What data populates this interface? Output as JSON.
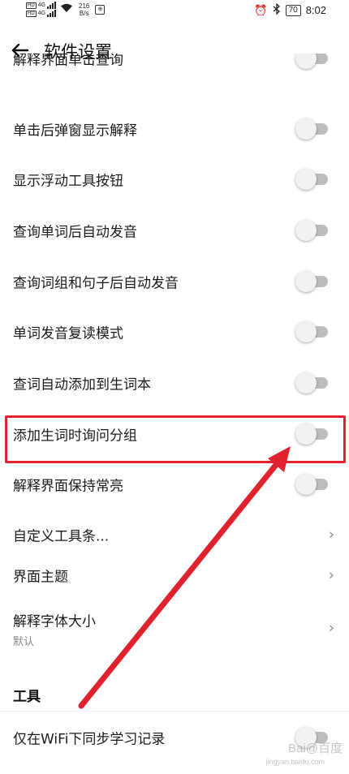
{
  "status_bar": {
    "sim1_label": "HD",
    "sim1_net": "4G",
    "sim2_label": "HD",
    "sim2_net": "4G",
    "net_speed_value": "216",
    "net_speed_unit": "B/s",
    "battery": "70",
    "time": "8:02"
  },
  "header": {
    "title": "软件设置"
  },
  "settings": {
    "partial_item": "解释界面单击查询",
    "items": [
      {
        "label": "单击后弹窗显示解释",
        "on": false
      },
      {
        "label": "显示浮动工具按钮",
        "on": false
      },
      {
        "label": "查询单词后自动发音",
        "on": false
      },
      {
        "label": "查询词组和句子后自动发音",
        "on": false
      },
      {
        "label": "单词发音复读模式",
        "on": false
      },
      {
        "label": "查词自动添加到生词本",
        "on": false
      },
      {
        "label": "添加生词时询问分组",
        "on": false
      },
      {
        "label": "解释界面保持常亮",
        "on": false
      }
    ],
    "nav_items": [
      {
        "label": "自定义工具条..."
      },
      {
        "label": "界面主题"
      },
      {
        "label": "解释字体大小",
        "sub": "默认"
      }
    ]
  },
  "tools_section": {
    "header": "工具",
    "items": [
      {
        "label": "仅在WiFi下同步学习记录",
        "on": false
      }
    ]
  },
  "annotation": {
    "color": "#e0212e"
  },
  "watermark": {
    "text": "Bai@百度",
    "sub": "jingyan.baidu.com"
  }
}
